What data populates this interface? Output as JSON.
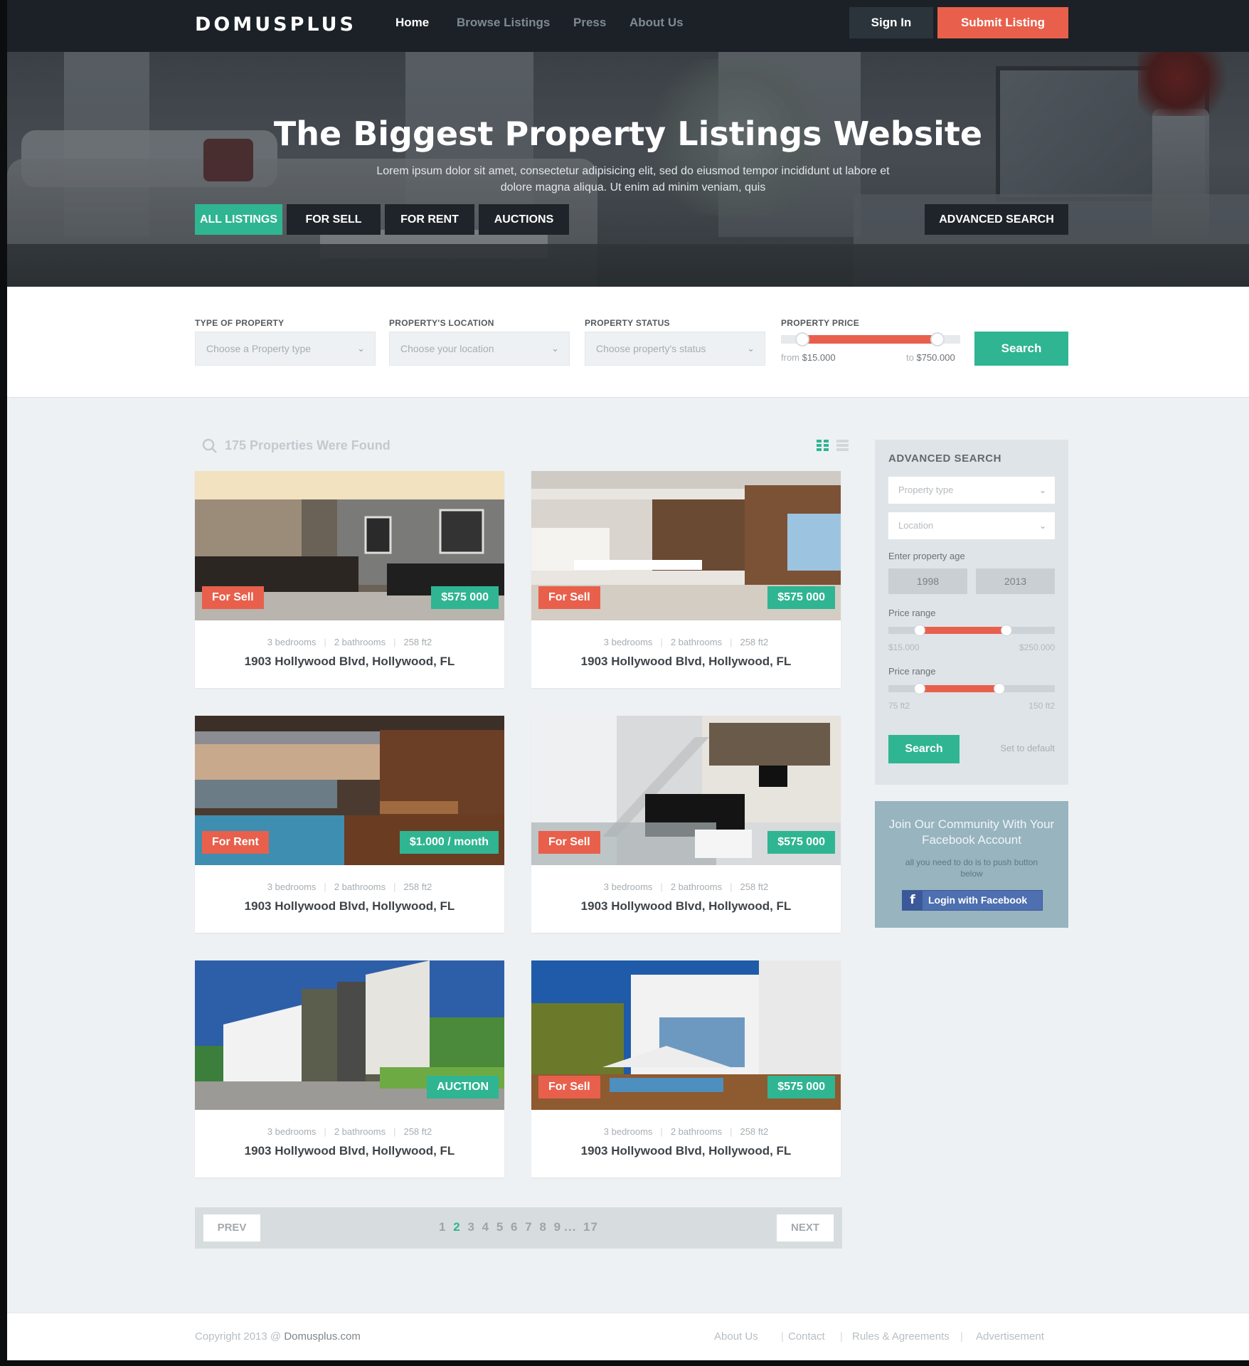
{
  "nav": {
    "logo": "DOMUSPLUS",
    "links": [
      "Home",
      "Browse Listings",
      "Press",
      "About Us"
    ],
    "sign_in": "Sign In",
    "submit": "Submit Listing"
  },
  "hero": {
    "title": "The Biggest Property Listings Website",
    "subtitle": "Lorem ipsum dolor sit amet, consectetur adipisicing elit, sed do eiusmod tempor incididunt ut labore et dolore magna aliqua. Ut enim ad minim veniam, quis",
    "tabs": [
      "ALL LISTINGS",
      "FOR SELL",
      "FOR RENT",
      "AUCTIONS"
    ],
    "advanced": "ADVANCED SEARCH"
  },
  "filter": {
    "type_label": "TYPE OF PROPERTY",
    "type_placeholder": "Choose a Property type",
    "location_label": "PROPERTY'S LOCATION",
    "location_placeholder": "Choose your location",
    "status_label": "PROPERTY STATUS",
    "status_placeholder": "Choose property's status",
    "price_label": "PROPERTY PRICE",
    "price_from_prefix": "from",
    "price_from": "$15.000",
    "price_to_prefix": "to",
    "price_to": "$750.000",
    "search": "Search"
  },
  "results": {
    "count_text": "175 Properties Were Found",
    "listings": [
      {
        "status": "For Sell",
        "price": "$575 000",
        "bedrooms": "3 bedrooms",
        "bathrooms": "2 bathrooms",
        "area": "258 ft2",
        "address": "1903 Hollywood Blvd, Hollywood, FL"
      },
      {
        "status": "For Sell",
        "price": "$575 000",
        "bedrooms": "3 bedrooms",
        "bathrooms": "2 bathrooms",
        "area": "258 ft2",
        "address": "1903 Hollywood Blvd, Hollywood, FL"
      },
      {
        "status": "For Rent",
        "price": "$1.000 / month",
        "bedrooms": "3 bedrooms",
        "bathrooms": "2 bathrooms",
        "area": "258 ft2",
        "address": "1903 Hollywood Blvd, Hollywood, FL"
      },
      {
        "status": "For Sell",
        "price": "$575 000",
        "bedrooms": "3 bedrooms",
        "bathrooms": "2 bathrooms",
        "area": "258 ft2",
        "address": "1903 Hollywood Blvd, Hollywood, FL"
      },
      {
        "status": "",
        "price": "AUCTION",
        "bedrooms": "3 bedrooms",
        "bathrooms": "2 bathrooms",
        "area": "258 ft2",
        "address": "1903 Hollywood Blvd, Hollywood, FL"
      },
      {
        "status": "For Sell",
        "price": "$575 000",
        "bedrooms": "3 bedrooms",
        "bathrooms": "2 bathrooms",
        "area": "258 ft2",
        "address": "1903 Hollywood Blvd, Hollywood, FL"
      }
    ]
  },
  "pager": {
    "prev": "PREV",
    "next": "NEXT",
    "pages": [
      "1",
      "2",
      "3",
      "4",
      "5",
      "6",
      "7",
      "8",
      "9",
      "...",
      "17"
    ],
    "current": "2"
  },
  "sidebar": {
    "title": "ADVANCED SEARCH",
    "type_placeholder": "Property type",
    "location_placeholder": "Location",
    "age_label": "Enter property age",
    "age_from": "1998",
    "age_to": "2013",
    "price_label": "Price range",
    "price_min": "$15.000",
    "price_max": "$250.000",
    "area_label": "Price range",
    "area_min": "75 ft2",
    "area_max": "150 ft2",
    "search": "Search",
    "reset": "Set to default"
  },
  "facebook": {
    "title": "Join Our Community With Your Facebook Account",
    "subtitle": "all you need to do is to push button below",
    "button": "Login with Facebook"
  },
  "footer": {
    "copyright_prefix": "Copyright 2013 @",
    "copyright_site": "Domusplus.com",
    "links": [
      "About Us",
      "Contact",
      "Rules & Agreements",
      "Advertisement"
    ]
  },
  "colors": {
    "accent_green": "#2fb592",
    "accent_red": "#e8604c",
    "nav_dark": "#1b2126"
  },
  "icons": [
    "search-icon",
    "grid-view-icon",
    "list-view-icon",
    "chevron-down-icon",
    "facebook-icon"
  ]
}
